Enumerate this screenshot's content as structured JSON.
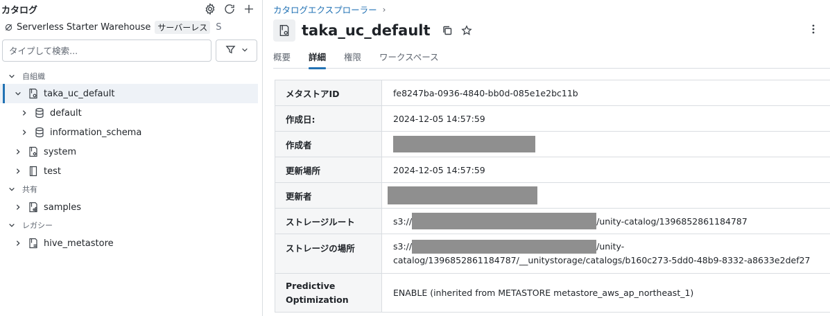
{
  "sidebar": {
    "title": "カタログ",
    "warehouse": {
      "name": "Serverless Starter Warehouse",
      "badge": "サーバーレス",
      "suffix": "S"
    },
    "search": {
      "placeholder": "タイプして検索..."
    },
    "groups": [
      {
        "label": "自組織"
      },
      {
        "label": "共有"
      },
      {
        "label": "レガシー"
      }
    ],
    "items": [
      {
        "label": "taka_uc_default"
      },
      {
        "label": "default"
      },
      {
        "label": "information_schema"
      },
      {
        "label": "system"
      },
      {
        "label": "test"
      },
      {
        "label": "samples"
      },
      {
        "label": "hive_metastore"
      }
    ]
  },
  "main": {
    "breadcrumb": {
      "root": "カタログエクスプローラー",
      "separator": "›"
    },
    "title": "taka_uc_default",
    "tabs": [
      {
        "label": "概要"
      },
      {
        "label": "詳細",
        "active": true
      },
      {
        "label": "権限"
      },
      {
        "label": "ワークスペース"
      }
    ],
    "details": {
      "metastore_id": {
        "key": "メタストアID",
        "value": "fe8247ba-0936-4840-bb0d-085e1e2bc11b"
      },
      "created_at": {
        "key": "作成日:",
        "value": "2024-12-05 14:57:59"
      },
      "created_by": {
        "key": "作成者",
        "value": ""
      },
      "updated_place": {
        "key": "更新場所",
        "value": "2024-12-05 14:57:59"
      },
      "updated_by": {
        "key": "更新者",
        "value": ""
      },
      "storage_root": {
        "key": "ストレージルート",
        "prefix": "s3://",
        "suffix": "/unity-catalog/1396852861184787"
      },
      "storage_location": {
        "key": "ストレージの場所",
        "prefix": "s3://",
        "suffix_line1": "/unity-",
        "line2": "catalog/1396852861184787/__unitystorage/catalogs/b160c273-5dd0-48b9-8332-a8633e2def27"
      },
      "predictive_optimization": {
        "key_line1": "Predictive",
        "key_line2": "Optimization",
        "value": "ENABLE (inherited from METASTORE metastore_aws_ap_northeast_1)"
      }
    }
  },
  "colors": {
    "accent": "#2272b4",
    "selected_bg": "#eef2f7",
    "key_bg": "#f5f6f7",
    "border": "#d9dde1",
    "redaction": "#8f8f8f"
  }
}
